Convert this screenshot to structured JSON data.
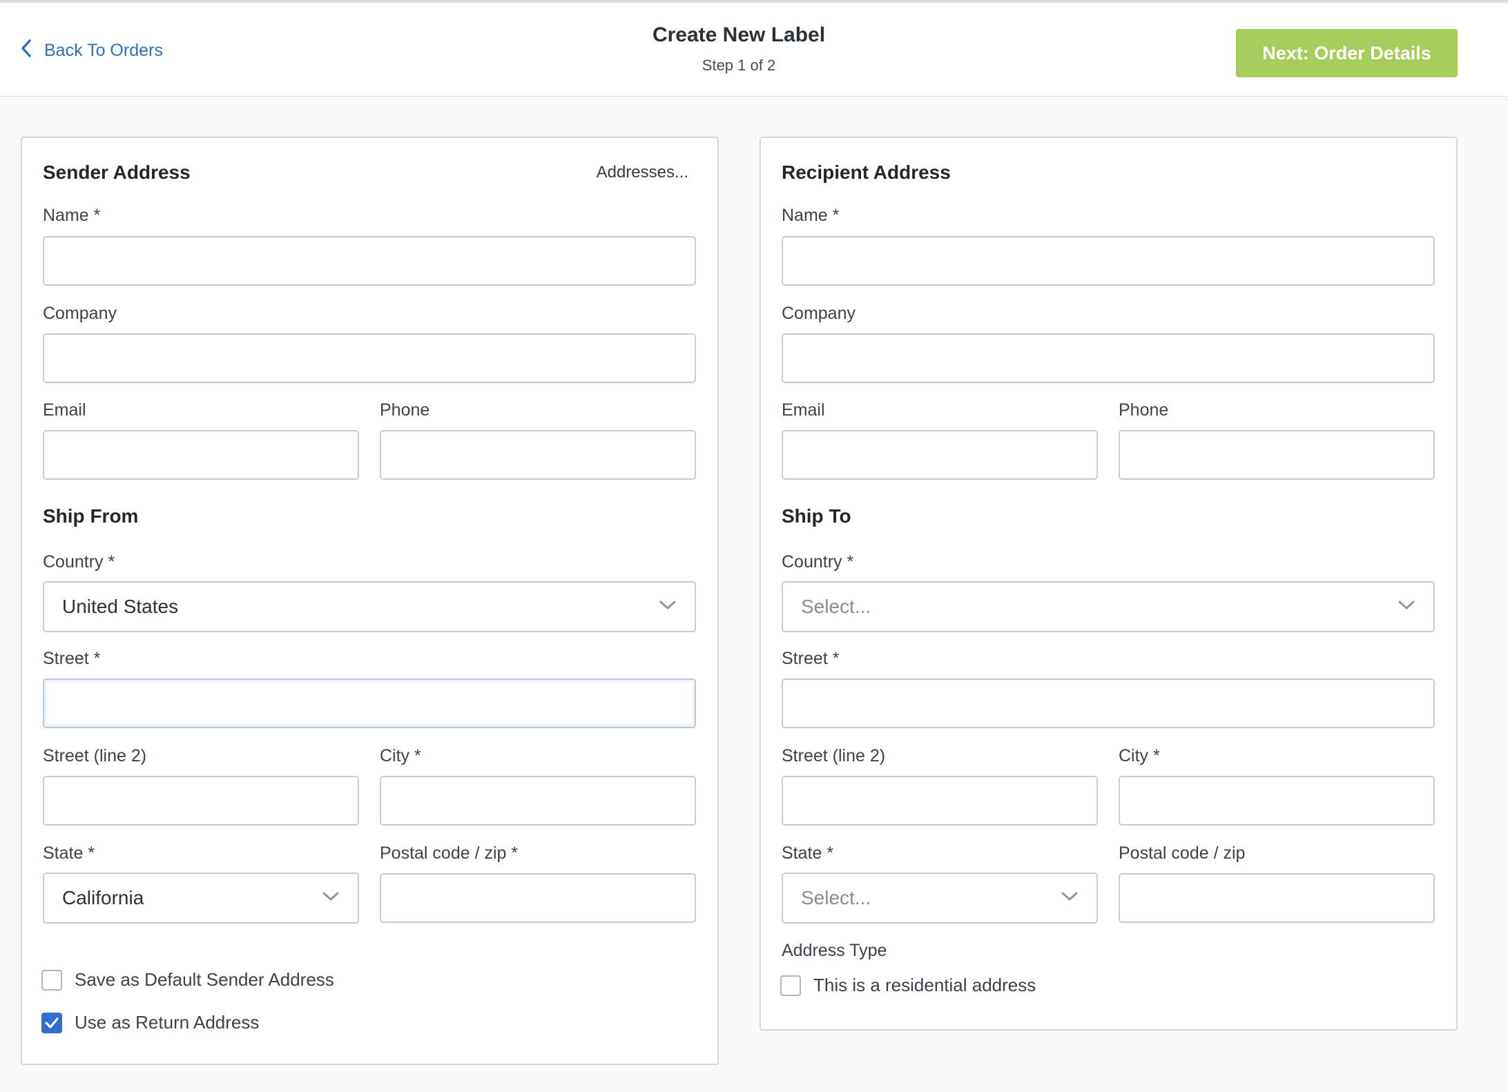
{
  "header": {
    "back_label": "Back To Orders",
    "title": "Create New Label",
    "step": "Step 1 of 2",
    "next_label": "Next: Order Details"
  },
  "colors": {
    "accent_blue": "#2f6fbf",
    "next_button": "#a6cd5c",
    "checkbox_checked": "#2f6fd0"
  },
  "sender": {
    "title": "Sender Address",
    "addresses_link": "Addresses...",
    "name_label": "Name *",
    "name_value": "",
    "company_label": "Company",
    "company_value": "",
    "email_label": "Email",
    "email_value": "",
    "phone_label": "Phone",
    "phone_value": "",
    "ship_section": "Ship From",
    "country_label": "Country *",
    "country_value": "United States",
    "street_label": "Street *",
    "street_value": "",
    "street2_label": "Street (line 2)",
    "street2_value": "",
    "city_label": "City *",
    "city_value": "",
    "state_label": "State *",
    "state_value": "California",
    "postal_label": "Postal code / zip *",
    "postal_value": "",
    "save_default_label": "Save as Default Sender Address",
    "save_default_checked": false,
    "return_label": "Use as Return Address",
    "return_checked": true
  },
  "recipient": {
    "title": "Recipient Address",
    "name_label": "Name *",
    "name_value": "",
    "company_label": "Company",
    "company_value": "",
    "email_label": "Email",
    "email_value": "",
    "phone_label": "Phone",
    "phone_value": "",
    "ship_section": "Ship To",
    "country_label": "Country *",
    "country_placeholder": "Select...",
    "street_label": "Street *",
    "street_value": "",
    "street2_label": "Street (line 2)",
    "street2_value": "",
    "city_label": "City *",
    "city_value": "",
    "state_label": "State *",
    "state_placeholder": "Select...",
    "postal_label": "Postal code / zip",
    "postal_value": "",
    "address_type_label": "Address Type",
    "residential_label": "This is a residential address",
    "residential_checked": false
  }
}
